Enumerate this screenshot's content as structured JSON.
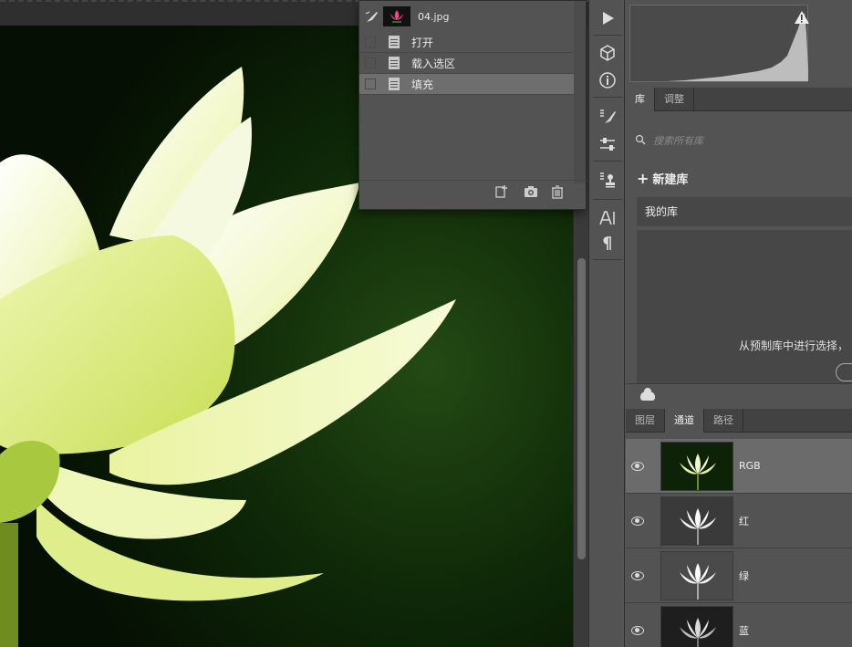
{
  "history": {
    "snapshot_name": "04.jpg",
    "steps": [
      {
        "label": "打开"
      },
      {
        "label": "载入选区"
      },
      {
        "label": "填充"
      }
    ]
  },
  "libraries": {
    "tabs": [
      {
        "label": "库"
      },
      {
        "label": "调整"
      }
    ],
    "search_placeholder": "搜索所有库",
    "new_library": "新建库",
    "my_library": "我的库",
    "hint_text": "从预制库中进行选择，"
  },
  "layers_panel": {
    "tabs": [
      {
        "label": "图层"
      },
      {
        "label": "通道"
      },
      {
        "label": "路径"
      }
    ],
    "channels": [
      {
        "name": "RGB"
      },
      {
        "name": "红"
      },
      {
        "name": "绿"
      },
      {
        "name": "蓝"
      }
    ]
  },
  "colors": {
    "petal": "#e8f5a8",
    "background": "#0d2207",
    "panel": "#535353",
    "selected": "#6e6e6e"
  }
}
